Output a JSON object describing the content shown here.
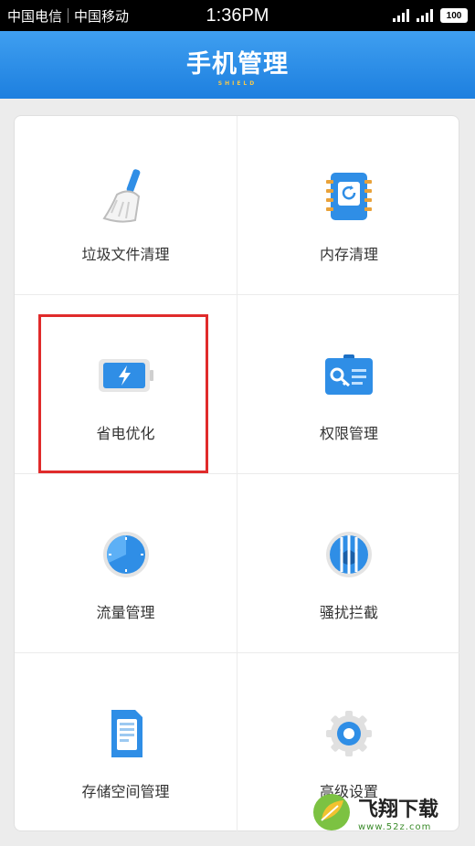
{
  "status_bar": {
    "carrier1": "中国电信",
    "carrier2": "中国移动",
    "time": "1:36PM",
    "battery": "100"
  },
  "header": {
    "title": "手机管理",
    "subtitle": "SHIELD"
  },
  "grid": [
    {
      "label": "垃圾文件清理",
      "icon": "broom-icon"
    },
    {
      "label": "内存清理",
      "icon": "memory-book-icon"
    },
    {
      "label": "省电优化",
      "icon": "battery-bolt-icon"
    },
    {
      "label": "权限管理",
      "icon": "key-card-icon"
    },
    {
      "label": "流量管理",
      "icon": "clock-pie-icon"
    },
    {
      "label": "骚扰拦截",
      "icon": "bat-shield-icon"
    },
    {
      "label": "存储空间管理",
      "icon": "storage-card-icon"
    },
    {
      "label": "高级设置",
      "icon": "gear-icon"
    }
  ],
  "watermark": {
    "title": "飞翔下载",
    "url": "www.52z.com"
  },
  "colors": {
    "header": "#1d7fdf",
    "icon_blue": "#2f8ee6",
    "highlight": "#e02b2b"
  }
}
